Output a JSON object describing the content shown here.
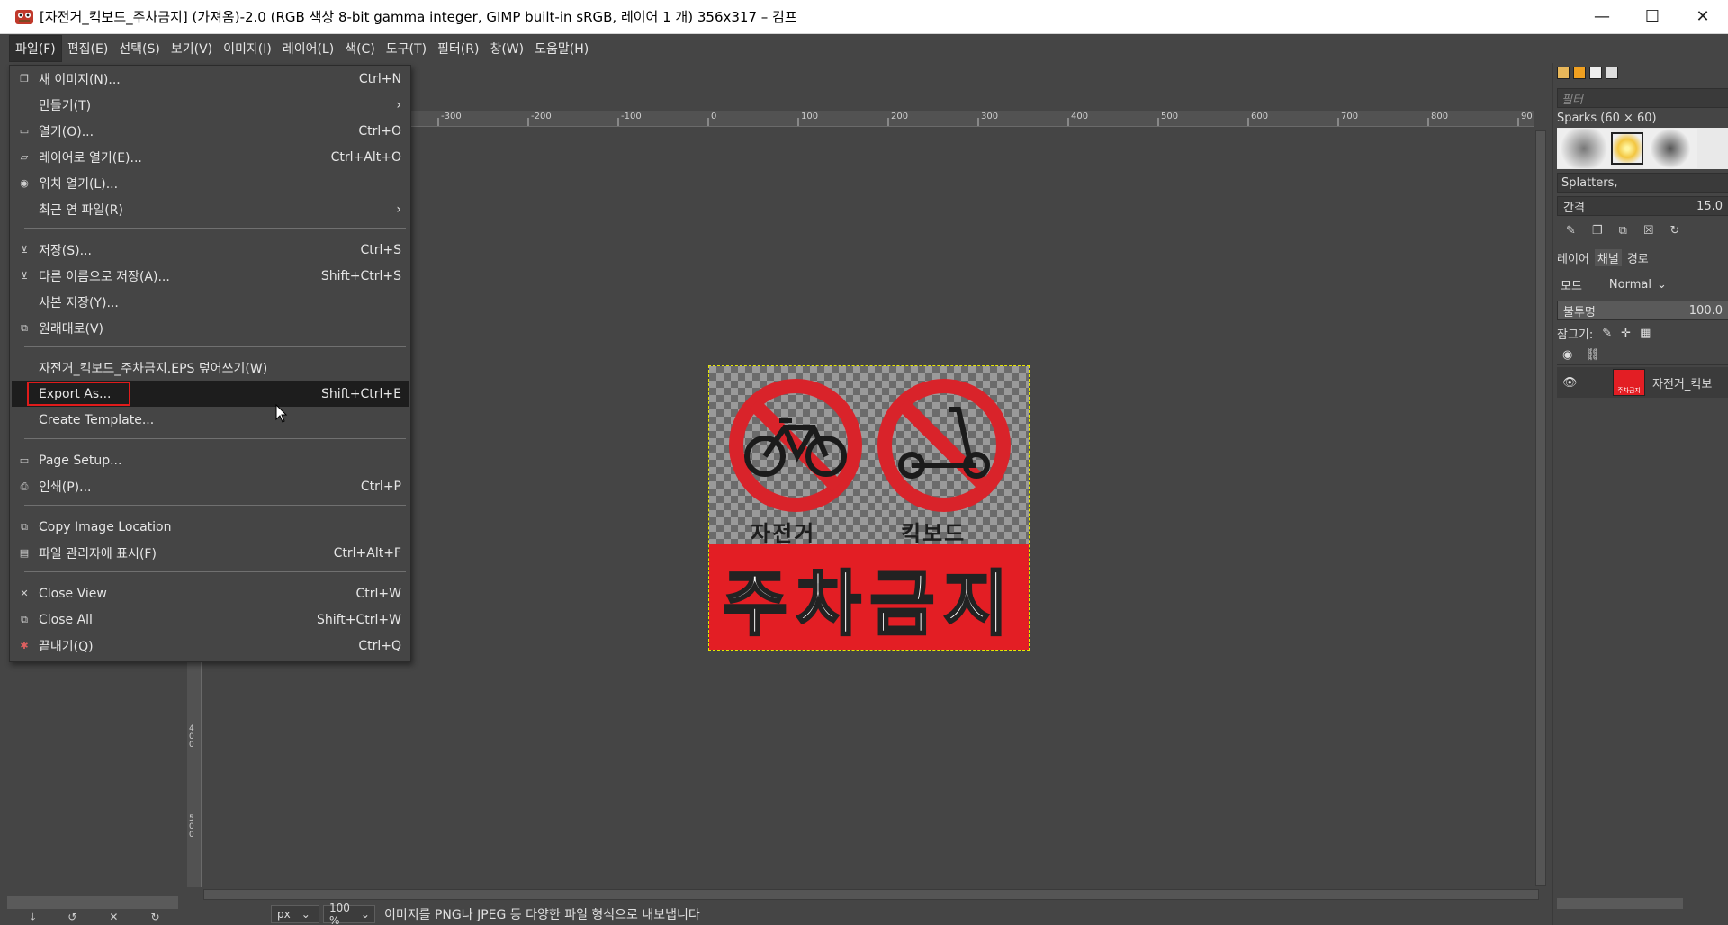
{
  "window": {
    "title": "[자전거_킥보드_주차금지] (가져옴)-2.0 (RGB 색상 8-bit gamma integer, GIMP built-in sRGB, 레이어 1 개) 356x317 – 김프",
    "minimize": "—",
    "maximize": "☐",
    "close": "✕"
  },
  "menubar": [
    "파일(F)",
    "편집(E)",
    "선택(S)",
    "보기(V)",
    "이미지(I)",
    "레이어(L)",
    "색(C)",
    "도구(T)",
    "필터(R)",
    "창(W)",
    "도움말(H)"
  ],
  "file_menu": [
    {
      "icon": "new-image-icon",
      "glyph": "❐",
      "label": "새 이미지(N)...",
      "shortcut": "Ctrl+N"
    },
    {
      "icon": "",
      "glyph": "",
      "label": "만들기(T)",
      "shortcut": "›"
    },
    {
      "icon": "open-icon",
      "glyph": "▭",
      "label": "열기(O)...",
      "shortcut": "Ctrl+O"
    },
    {
      "icon": "open-as-layers-icon",
      "glyph": "▱",
      "label": "레이어로 열기(E)...",
      "shortcut": "Ctrl+Alt+O"
    },
    {
      "icon": "open-location-icon",
      "glyph": "◉",
      "label": "위치 열기(L)...",
      "shortcut": ""
    },
    {
      "icon": "",
      "glyph": "",
      "label": "최근 연 파일(R)",
      "shortcut": "›"
    },
    {
      "icon": "save-icon",
      "glyph": "⊻",
      "label": "저장(S)...",
      "shortcut": "Ctrl+S"
    },
    {
      "icon": "save-as-icon",
      "glyph": "⊻",
      "label": "다른 이름으로 저장(A)...",
      "shortcut": "Shift+Ctrl+S"
    },
    {
      "icon": "",
      "glyph": "",
      "label": "사본 저장(Y)...",
      "shortcut": ""
    },
    {
      "icon": "revert-icon",
      "glyph": "⧉",
      "label": "원래대로(V)",
      "shortcut": ""
    },
    {
      "icon": "",
      "glyph": "",
      "label": "자전거_킥보드_주차금지.EPS 덮어쓰기(W)",
      "shortcut": ""
    },
    {
      "icon": "",
      "glyph": "",
      "label": "Export As...",
      "shortcut": "Shift+Ctrl+E"
    },
    {
      "icon": "",
      "glyph": "",
      "label": "Create Template...",
      "shortcut": ""
    },
    {
      "icon": "page-setup-icon",
      "glyph": "",
      "label": "Page Setup...",
      "shortcut": ""
    },
    {
      "icon": "print-icon",
      "glyph": "⎙",
      "label": "인쇄(P)...",
      "shortcut": "Ctrl+P"
    },
    {
      "icon": "copy-location-icon",
      "glyph": "⧉",
      "label": "Copy Image Location",
      "shortcut": ""
    },
    {
      "icon": "file-manager-icon",
      "glyph": "▤",
      "label": "파일 관리자에 표시(F)",
      "shortcut": "Ctrl+Alt+F"
    },
    {
      "icon": "close-view-icon",
      "glyph": "✕",
      "label": "Close View",
      "shortcut": "Ctrl+W"
    },
    {
      "icon": "close-all-icon",
      "glyph": "⧉",
      "label": "Close All",
      "shortcut": "Shift+Ctrl+W"
    },
    {
      "icon": "quit-icon",
      "glyph": "✱",
      "label": "끝내기(Q)",
      "shortcut": "Ctrl+Q"
    }
  ],
  "ruler_h": [
    "-300",
    "-200",
    "-100",
    "0",
    "100",
    "200",
    "300",
    "400",
    "500",
    "600",
    "700",
    "800",
    "90"
  ],
  "ruler_v": [
    "4\n0\n0",
    "5\n0\n0"
  ],
  "image": {
    "label_left": "자전거",
    "label_right": "킥보드",
    "banner": "주차금지"
  },
  "statusbar": {
    "unit": "px",
    "zoom": "100 %",
    "message": "이미지를 PNG나 JPEG 등 다양한 파일 형식으로 내보냅니다"
  },
  "dock": {
    "filter_placeholder": "필터",
    "brush_name": "Sparks (60 × 60)",
    "brush_set": "Splatters,",
    "spacing_label": "간격",
    "spacing_value": "15.0",
    "tabs": [
      "레이어",
      "채널",
      "경로"
    ],
    "mode_label": "모드",
    "mode_value": "Normal",
    "opacity_label": "불투명",
    "opacity_value": "100.0",
    "lock_label": "잠그기:",
    "layer_name": "자전거_킥보",
    "thumb_text": "주차금지"
  },
  "colors": {
    "accent_red": "#e31e24",
    "highlight_box": "#e01b1b",
    "menu_highlight": "#1d1d1d"
  }
}
